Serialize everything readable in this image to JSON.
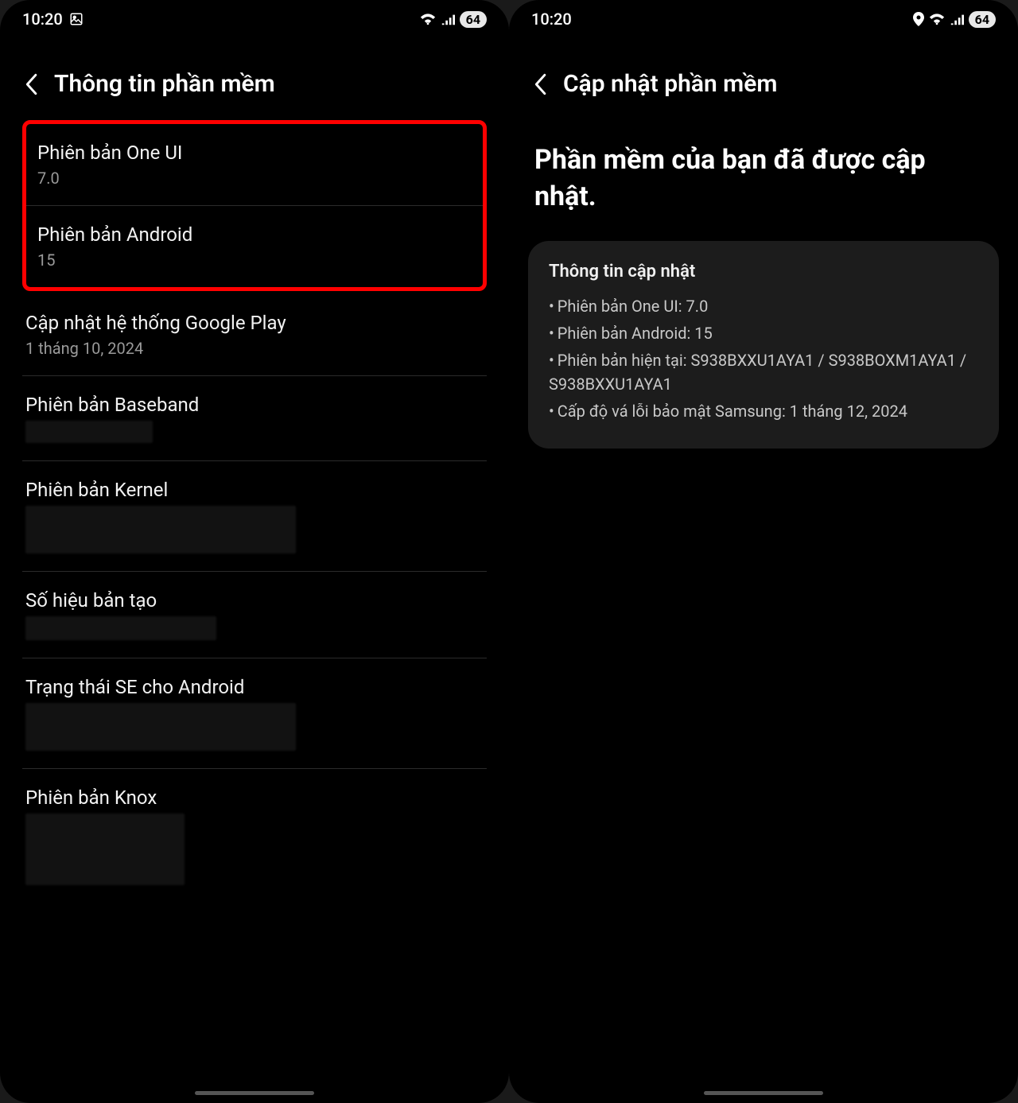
{
  "status": {
    "time": "10:20",
    "battery": "64"
  },
  "left": {
    "title": "Thông tin phần mềm",
    "items": [
      {
        "label": "Phiên bản One UI",
        "value": "7.0"
      },
      {
        "label": "Phiên bản Android",
        "value": "15"
      },
      {
        "label": "Cập nhật hệ thống Google Play",
        "value": "1 tháng 10, 2024"
      },
      {
        "label": "Phiên bản Baseband",
        "value": ""
      },
      {
        "label": "Phiên bản Kernel",
        "value": ""
      },
      {
        "label": "Số hiệu bản tạo",
        "value": ""
      },
      {
        "label": "Trạng thái SE cho Android",
        "value": ""
      },
      {
        "label": "Phiên bản Knox",
        "value": ""
      }
    ]
  },
  "right": {
    "title": "Cập nhật phần mềm",
    "headline": "Phần mềm của bạn đã được cập nhật.",
    "card": {
      "title": "Thông tin cập nhật",
      "lines": [
        "Phiên bản One UI: 7.0",
        "Phiên bản Android: 15",
        "Phiên bản hiện tại: S938BXXU1AYA1 / S938BOXM1AYA1 / S938BXXU1AYA1",
        "Cấp độ vá lỗi bảo mật Samsung: 1 tháng 12, 2024"
      ]
    }
  }
}
